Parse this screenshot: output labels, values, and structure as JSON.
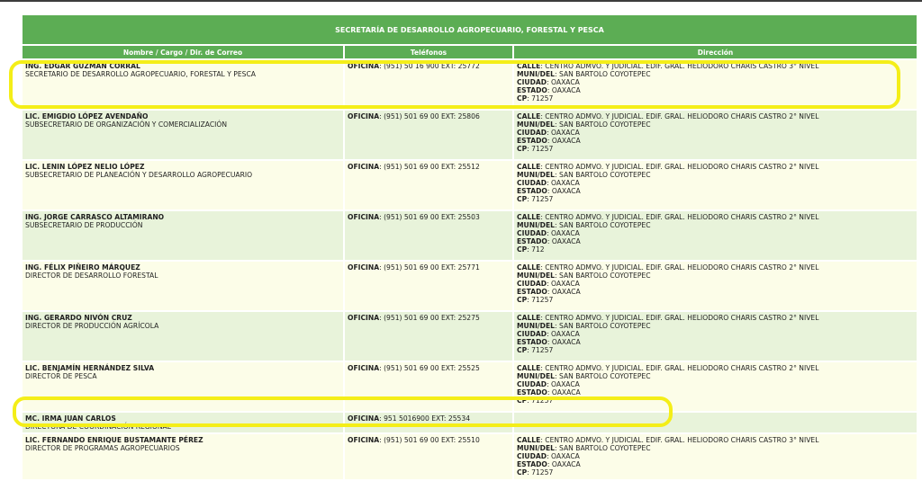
{
  "table": {
    "title": "SECRETARÍA DE DESARROLLO AGROPECUARIO, FORESTAL Y PESCA",
    "headers": [
      "Nombre / Cargo / Dir. de Correo",
      "Teléfonos",
      "Dirección"
    ],
    "rows": [
      {
        "name": "ING. EDGAR GUZMAN CORRAL",
        "position": "SECRETARIO DE DESARROLLO AGROPECUARIO, FORESTAL Y PESCA",
        "phone_label": "OFICINA",
        "phone": ": (951) 50 16 900 EXT: 25772",
        "addr": [
          [
            "CALLE",
            ": CENTRO ADMVO. Y JUDICIAL. EDIF. GRAL. HELIODORO CHARIS CASTRO 3° NIVEL"
          ],
          [
            "MUNI/DEL",
            ": SAN BARTOLO COYOTEPEC"
          ],
          [
            "CIUDAD",
            ": OAXACA"
          ],
          [
            "ESTADO",
            ": OAXACA"
          ],
          [
            "CP",
            ": 71257"
          ]
        ]
      },
      {
        "name": "LIC. EMIGDIO LÓPEZ AVENDAÑO",
        "position": "SUBSECRETARIO DE ORGANIZACIÓN Y COMERCIALIZACIÓN",
        "phone_label": "OFICINA",
        "phone": ": (951) 501 69 00 EXT: 25806",
        "addr": [
          [
            "CALLE",
            ": CENTRO ADMVO. Y JUDICIAL. EDIF. GRAL. HELIODORO CHARIS CASTRO 2° NIVEL"
          ],
          [
            "MUNI/DEL",
            ": SAN BARTOLO COYOTEPEC"
          ],
          [
            "CIUDAD",
            ": OAXACA"
          ],
          [
            "ESTADO",
            ": OAXACA"
          ],
          [
            "CP",
            ": 71257"
          ]
        ]
      },
      {
        "name": "LIC. LENIN LÓPEZ NELIO LÓPEZ",
        "position": "SUBSECRETARIO DE PLANEACIÓN Y DESARROLLO AGROPECUARIO",
        "phone_label": "OFICINA",
        "phone": ": (951) 501 69 00 EXT: 25512",
        "addr": [
          [
            "CALLE",
            ": CENTRO ADMVO. Y JUDICIAL. EDIF. GRAL. HELIODORO CHARIS CASTRO 2° NIVEL"
          ],
          [
            "MUNI/DEL",
            ": SAN BARTOLO COYOTEPEC"
          ],
          [
            "CIUDAD",
            ": OAXACA"
          ],
          [
            "ESTADO",
            ": OAXACA"
          ],
          [
            "CP",
            ": 71257"
          ]
        ]
      },
      {
        "name": "ING. JORGE CARRASCO ALTAMIRANO",
        "position": "SUBSECRETARIO DE PRODUCCIÓN",
        "phone_label": "OFICINA",
        "phone": ": (951) 501 69 00 EXT: 25503",
        "addr": [
          [
            "CALLE",
            ": CENTRO ADMVO. Y JUDICIAL. EDIF. GRAL. HELIODORO CHARIS CASTRO 2° NIVEL"
          ],
          [
            "MUNI/DEL",
            ": SAN BARTOLO COYOTEPEC"
          ],
          [
            "CIUDAD",
            ": OAXACA"
          ],
          [
            "ESTADO",
            ": OAXACA"
          ],
          [
            "CP",
            ": 712"
          ]
        ]
      },
      {
        "name": "ING. FÉLIX PIÑEIRO MÁRQUEZ",
        "position": "DIRECTOR DE DESARROLLO FORESTAL",
        "phone_label": "OFICINA",
        "phone": ": (951) 501 69 00 EXT: 25771",
        "addr": [
          [
            "CALLE",
            ": CENTRO ADMVO. Y JUDICIAL. EDIF. GRAL. HELIODORO CHARIS CASTRO 2° NIVEL"
          ],
          [
            "MUNI/DEL",
            ": SAN BARTOLO COYOTEPEC"
          ],
          [
            "CIUDAD",
            ": OAXACA"
          ],
          [
            "ESTADO",
            ": OAXACA"
          ],
          [
            "CP",
            ": 71257"
          ]
        ]
      },
      {
        "name": "ING. GERARDO NIVÓN CRUZ",
        "position": "DIRECTOR DE PRODUCCIÓN AGRÍCOLA",
        "phone_label": "OFICINA",
        "phone": ": (951) 501 69 00 EXT: 25275",
        "addr": [
          [
            "CALLE",
            ": CENTRO ADMVO. Y JUDICIAL. EDIF. GRAL. HELIODORO CHARIS CASTRO 2° NIVEL"
          ],
          [
            "MUNI/DEL",
            ": SAN BARTOLO COYOTEPEC"
          ],
          [
            "CIUDAD",
            ": OAXACA"
          ],
          [
            "ESTADO",
            ": OAXACA"
          ],
          [
            "CP",
            ": 71257"
          ]
        ]
      },
      {
        "name": "LIC. BENJAMÍN HERNÁNDEZ SILVA",
        "position": "DIRECTOR DE PESCA",
        "phone_label": "OFICINA",
        "phone": ": (951) 501 69 00 EXT: 25525",
        "addr": [
          [
            "CALLE",
            ": CENTRO ADMVO. Y JUDICIAL. EDIF. GRAL. HELIODORO CHARIS CASTRO 2° NIVEL"
          ],
          [
            "MUNI/DEL",
            ": SAN BARTOLO COYOTEPEC"
          ],
          [
            "CIUDAD",
            ": OAXACA"
          ],
          [
            "ESTADO",
            ": OAXACA"
          ],
          [
            "CP",
            ": 71257"
          ]
        ]
      },
      {
        "name": "MC. IRMA JUAN CARLOS",
        "position": "DIRECTORA DE COORDINACIÓN REGIONAL",
        "phone_label": "OFICINA",
        "phone": ": 951 5016900 EXT: 25534",
        "addr": []
      },
      {
        "name": "LIC. FERNANDO ENRIQUE BUSTAMANTE PÉREZ",
        "position": "DIRECTOR DE PROGRAMAS AGROPECUARIOS",
        "phone_label": "OFICINA",
        "phone": ": (951) 501 69 00 EXT: 25510",
        "addr": [
          [
            "CALLE",
            ": CENTRO ADMVO. Y JUDICIAL. EDIF. GRAL. HELIODORO CHARIS CASTRO 3° NIVEL"
          ],
          [
            "MUNI/DEL",
            ": SAN BARTOLO COYOTEPEC"
          ],
          [
            "CIUDAD",
            ": OAXACA"
          ],
          [
            "ESTADO",
            ": OAXACA"
          ],
          [
            "CP",
            ": 71257"
          ]
        ]
      }
    ]
  },
  "colors": {
    "header_green": "#5cad54",
    "row_light": "#fcfde8",
    "row_green": "#e8f3da",
    "highlight": "#f4ee18"
  }
}
